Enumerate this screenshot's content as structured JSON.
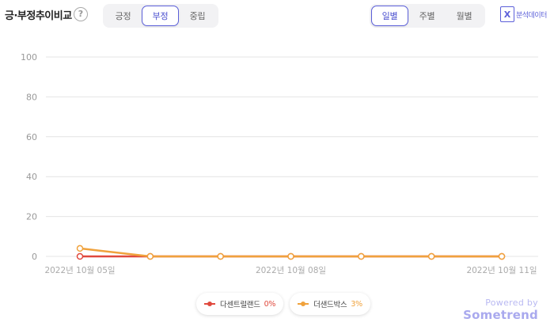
{
  "header": {
    "title": "긍·부정추이비교",
    "help_icon": "question-circle-icon"
  },
  "sentiment_filter": {
    "options": [
      "긍정",
      "부정",
      "중립"
    ],
    "selected": "부정"
  },
  "period_filter": {
    "options": [
      "일별",
      "주별",
      "월별"
    ],
    "selected": "일별"
  },
  "export": {
    "icon": "excel-icon",
    "icon_letter": "X",
    "label": "분석데이터"
  },
  "colors": {
    "accent": "#5b5fd9",
    "series_red": "#e0493d",
    "series_orange": "#f0a23c"
  },
  "chart_data": {
    "type": "line",
    "x": [
      "2022-10-05",
      "2022-10-06",
      "2022-10-07",
      "2022-10-08",
      "2022-10-09",
      "2022-10-10",
      "2022-10-11"
    ],
    "x_tick_labels": [
      "2022년 10월 05일",
      "",
      "",
      "2022년 10월 08일",
      "",
      "",
      "2022년 10월 11일"
    ],
    "ylim": [
      0,
      100
    ],
    "yticks": [
      0,
      20,
      40,
      60,
      80,
      100
    ],
    "grid": true,
    "series": [
      {
        "name": "다센트럴랜드",
        "values": [
          0,
          0,
          0,
          0,
          0,
          0,
          0
        ],
        "color": "#e0493d"
      },
      {
        "name": "더샌드박스",
        "values": [
          4,
          0,
          0,
          0,
          0,
          0,
          0
        ],
        "color": "#f0a23c"
      }
    ]
  },
  "legend": [
    {
      "name": "다센트럴랜드",
      "pct": "0%",
      "color": "#e0493d"
    },
    {
      "name": "더샌드박스",
      "pct": "3%",
      "color": "#f0a23c"
    }
  ],
  "branding": {
    "powered_by": "Powered by",
    "brand": "Sometrend"
  }
}
